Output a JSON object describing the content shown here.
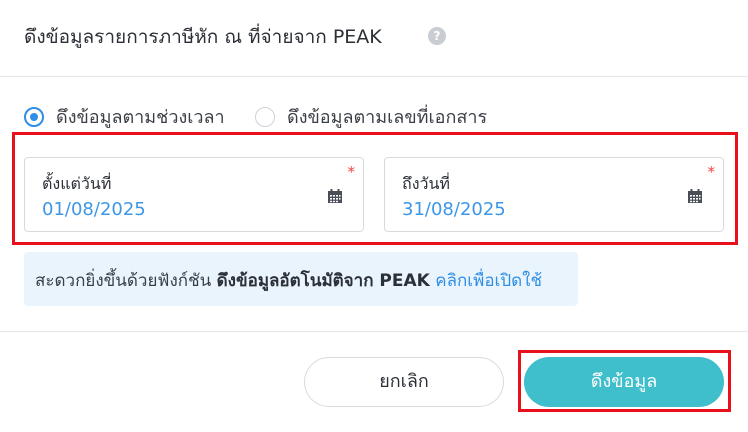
{
  "dialog": {
    "title": "ดึงข้อมูลรายการภาษีหัก ณ ที่จ่ายจาก PEAK",
    "help_icon": "question-circle-icon"
  },
  "mode_options": [
    {
      "label": "ดึงข้อมูลตามช่วงเวลา",
      "selected": true
    },
    {
      "label": "ดึงข้อมูลตามเลขที่เอกสาร",
      "selected": false
    }
  ],
  "date_from": {
    "label": "ตั้งแต่วันที่",
    "value": "01/08/2025",
    "required_mark": "*",
    "icon": "calendar-icon"
  },
  "date_to": {
    "label": "ถึงวันที่",
    "value": "31/08/2025",
    "required_mark": "*",
    "icon": "calendar-icon"
  },
  "promo": {
    "text": "สะดวกยิ่งขึ้นด้วยฟังก์ชัน ",
    "strong": "ดึงข้อมูลอัตโนมัติจาก PEAK",
    "link": "คลิกเพื่อเปิดใช้"
  },
  "buttons": {
    "cancel": "ยกเลิก",
    "fetch": "ดึงข้อมูล"
  },
  "colors": {
    "accent": "#2f8ee6",
    "primary_button": "#3fbfcc",
    "highlight_border": "#e8101c",
    "promo_bg": "#eaf4fd",
    "date_value": "#3d97e6"
  }
}
